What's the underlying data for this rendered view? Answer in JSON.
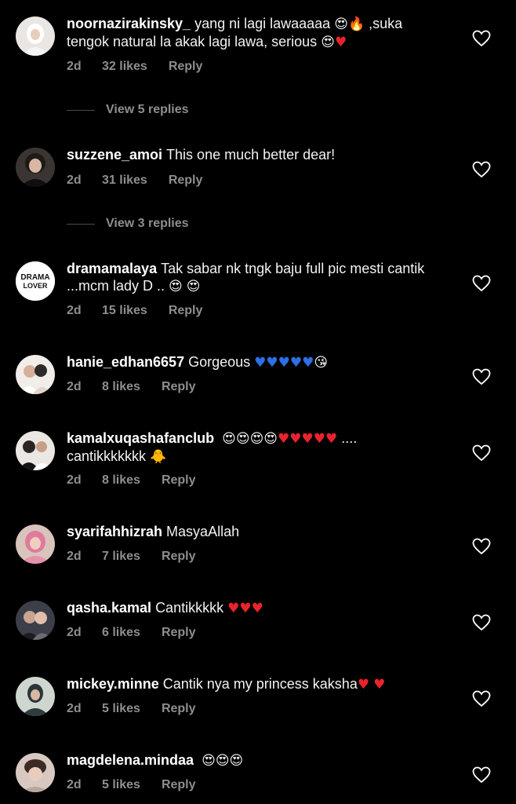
{
  "theme": {
    "background": "#000000",
    "text": "#ffffff",
    "muted": "#8e8e8e",
    "heart_red": "#e8232e",
    "heart_blue": "#2c6fe6"
  },
  "comments": [
    {
      "username": "noornazirakinsky_",
      "text_lines": [
        "yang ni lagi lawaaaaa",
        ",suka",
        "tengok natural la akak lagi lawa, serious"
      ],
      "time": "2d",
      "likes": "32 likes",
      "reply": "Reply",
      "view_replies": "View 5 replies"
    },
    {
      "username": "suzzene_amoi",
      "text": "This one much better dear!",
      "time": "2d",
      "likes": "31 likes",
      "reply": "Reply",
      "view_replies": "View 3 replies"
    },
    {
      "username": "dramamalaya",
      "text": "Tak sabar nk tngk baju full pic mesti cantik ...mcm lady D ..",
      "avatar_text": [
        "DRAMA",
        "LOVER"
      ],
      "time": "2d",
      "likes": "15 likes",
      "reply": "Reply"
    },
    {
      "username": "hanie_edhan6657",
      "text": "Gorgeous",
      "time": "2d",
      "likes": "8 likes",
      "reply": "Reply"
    },
    {
      "username": "kamalxuqashafanclub",
      "text_tail": "....",
      "text_line2": "cantikkkkkkk",
      "time": "2d",
      "likes": "8 likes",
      "reply": "Reply"
    },
    {
      "username": "syarifahhizrah",
      "text": "MasyaAllah",
      "time": "2d",
      "likes": "7 likes",
      "reply": "Reply"
    },
    {
      "username": "qasha.kamal",
      "text": "Cantikkkkk",
      "time": "2d",
      "likes": "6 likes",
      "reply": "Reply"
    },
    {
      "username": "mickey.minne",
      "text": "Cantik nya my princess kaksha",
      "time": "2d",
      "likes": "5 likes",
      "reply": "Reply"
    },
    {
      "username": "magdelena.mindaa",
      "text": "",
      "time": "2d",
      "likes": "5 likes",
      "reply": "Reply"
    }
  ]
}
